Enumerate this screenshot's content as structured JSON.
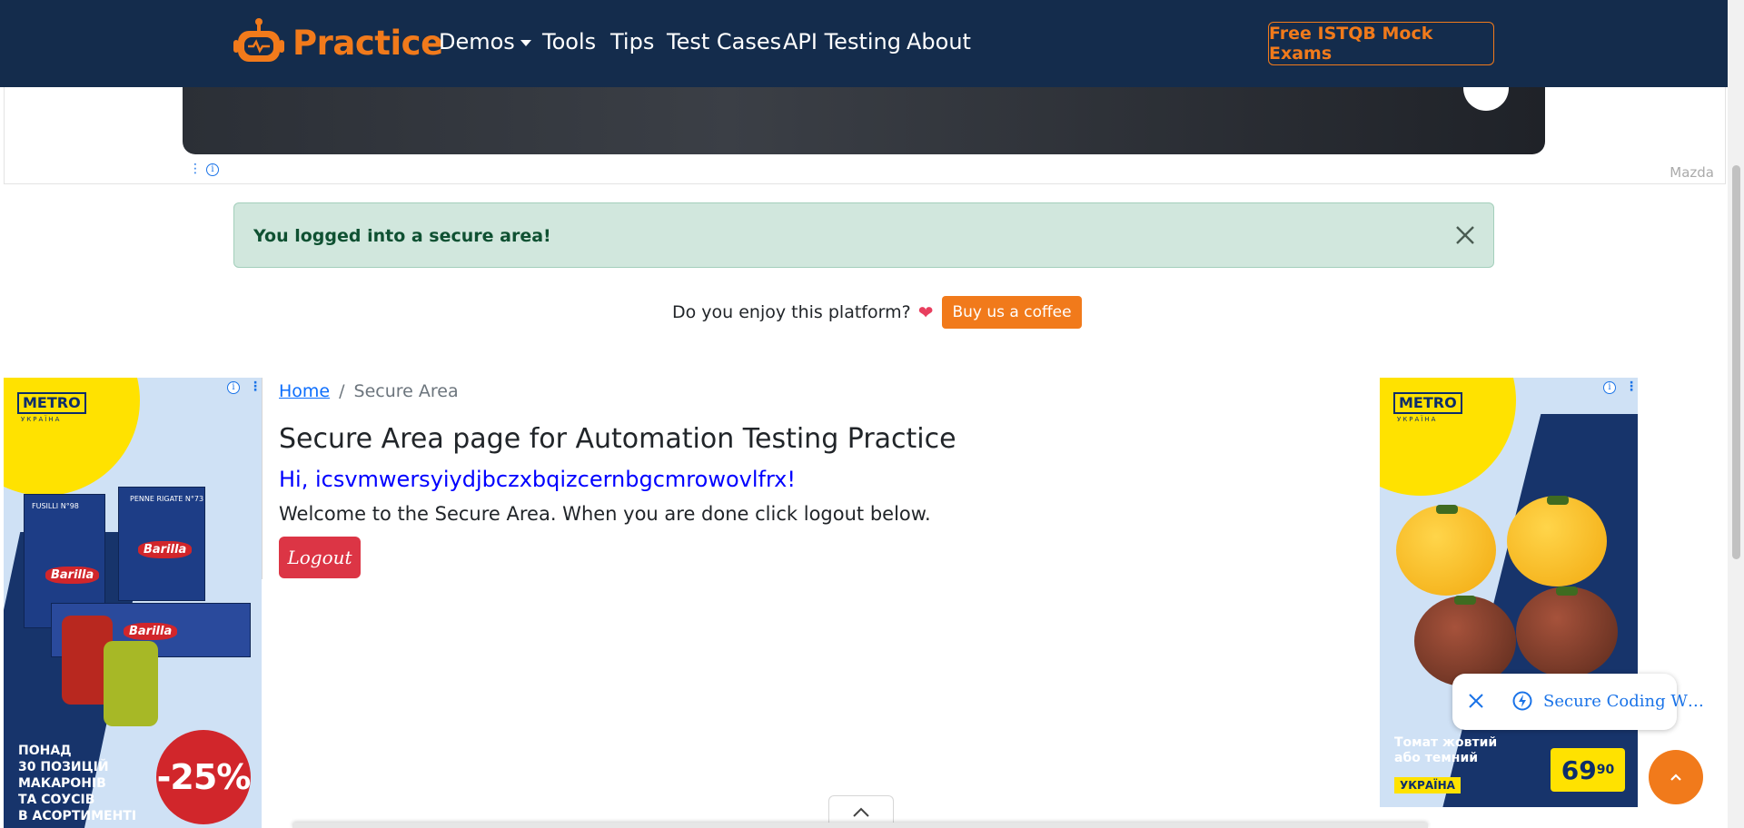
{
  "navbar": {
    "brand": "Practice",
    "items": [
      {
        "label": "Demos"
      },
      {
        "label": "Tools"
      },
      {
        "label": "Tips"
      },
      {
        "label": "Test Cases"
      },
      {
        "label": "API Testing"
      },
      {
        "label": "About"
      }
    ],
    "cta": "Free ISTQB Mock Exams"
  },
  "top_ad": {
    "brand": "Mazda",
    "info_icon": "info-icon",
    "menu_icon": "kebab-menu-icon"
  },
  "alert": {
    "message": "You logged into a secure area!",
    "close_icon": "close-icon"
  },
  "coffee": {
    "question": "Do you enjoy this platform?",
    "heart": "❤",
    "button": "Buy us a coffee"
  },
  "left_ad": {
    "logo": "METRO",
    "logo_sub": "УКРАЇНА",
    "product": "Barilla",
    "discount": "-25%",
    "promo_lines": [
      "ПОНАД",
      "30 ПОЗИЦІЙ",
      "МАКАРОНІВ",
      "ТА СОУСІВ",
      "В АСОРТИМЕНТІ"
    ]
  },
  "right_ad": {
    "logo": "METRO",
    "logo_sub": "УКРАЇНА",
    "text_lines": [
      "Томат жовтий",
      "або темний"
    ],
    "price_main": "69",
    "price_cents": "90",
    "country": "УКРАЇНА"
  },
  "breadcrumb": {
    "home": "Home",
    "separator": "/",
    "current": "Secure Area"
  },
  "content": {
    "title": "Secure Area page for Automation Testing Practice",
    "greeting": "Hi, icsvmwersyiydjbczxbqizcernbgcmrowovlfrx!",
    "welcome": "Welcome to the Secure Area. When you are done click logout below.",
    "logout": "Logout"
  },
  "toast": {
    "text": "Secure Coding W…",
    "close_icon": "close-icon",
    "bolt_icon": "bolt-icon"
  },
  "colors": {
    "navbar_bg": "#142c4c",
    "accent": "#f17a1b",
    "alert_bg": "#d1e7dd",
    "alert_text": "#0f5132",
    "logout_bg": "#dc3545",
    "greeting": "#0000ff"
  }
}
